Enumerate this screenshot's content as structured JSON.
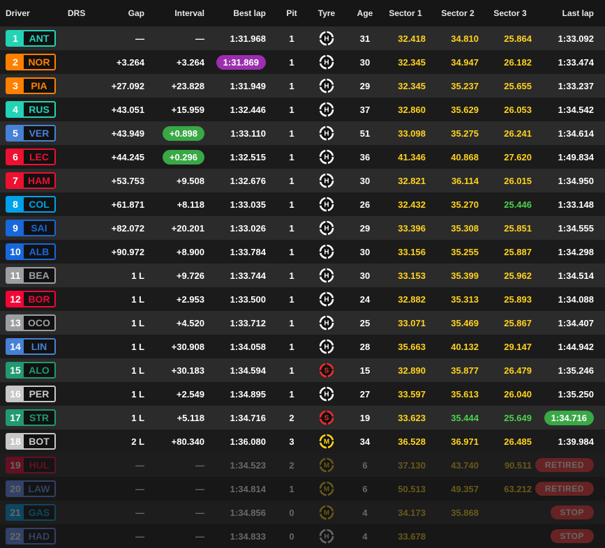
{
  "headers": {
    "driver": "Driver",
    "drs": "DRS",
    "gap": "Gap",
    "interval": "Interval",
    "best_lap": "Best lap",
    "pit": "Pit",
    "tyre": "Tyre",
    "age": "Age",
    "sector1": "Sector 1",
    "sector2": "Sector 2",
    "sector3": "Sector 3",
    "last_lap": "Last lap"
  },
  "tyre_colors": {
    "H": "#ffffff",
    "M": "#ffd21e",
    "S": "#ff2a2a"
  },
  "colors": {
    "fastest_purple": "#9b2fae",
    "personal_green": "#39a845",
    "sector_yellow": "#ffd21e",
    "retired_red": "#ff3b3b"
  },
  "rows": [
    {
      "pos": "1",
      "code": "ANT",
      "team": "#23d3b5",
      "gap": "—",
      "interval": "—",
      "best": "1:31.968",
      "pit": "1",
      "tyre": "H",
      "age": "31",
      "s1": "32.418",
      "s2": "34.810",
      "s3": "25.864",
      "last": "1:33.092"
    },
    {
      "pos": "2",
      "code": "NOR",
      "team": "#ff8000",
      "gap": "+3.264",
      "interval": "+3.264",
      "best": "1:31.869",
      "best_hl": "purple",
      "pit": "1",
      "tyre": "H",
      "age": "30",
      "s1": "32.345",
      "s2": "34.947",
      "s3": "26.182",
      "last": "1:33.474"
    },
    {
      "pos": "3",
      "code": "PIA",
      "team": "#ff8000",
      "gap": "+27.092",
      "interval": "+23.828",
      "best": "1:31.949",
      "pit": "1",
      "tyre": "H",
      "age": "29",
      "s1": "32.345",
      "s2": "35.237",
      "s3": "25.655",
      "last": "1:33.237"
    },
    {
      "pos": "4",
      "code": "RUS",
      "team": "#23d3b5",
      "gap": "+43.051",
      "interval": "+15.959",
      "best": "1:32.446",
      "pit": "1",
      "tyre": "H",
      "age": "37",
      "s1": "32.860",
      "s2": "35.629",
      "s3": "26.053",
      "last": "1:34.542"
    },
    {
      "pos": "5",
      "code": "VER",
      "team": "#4781d7",
      "gap": "+43.949",
      "interval": "+0.898",
      "int_hl": "green",
      "best": "1:33.110",
      "pit": "1",
      "tyre": "H",
      "age": "51",
      "s1": "33.098",
      "s2": "35.275",
      "s3": "26.241",
      "last": "1:34.614"
    },
    {
      "pos": "6",
      "code": "LEC",
      "team": "#ed1131",
      "gap": "+44.245",
      "interval": "+0.296",
      "int_hl": "green",
      "best": "1:32.515",
      "pit": "1",
      "tyre": "H",
      "age": "36",
      "s1": "41.346",
      "s2": "40.868",
      "s3": "27.620",
      "last": "1:49.834"
    },
    {
      "pos": "7",
      "code": "HAM",
      "team": "#ed1131",
      "gap": "+53.753",
      "interval": "+9.508",
      "best": "1:32.676",
      "pit": "1",
      "tyre": "H",
      "age": "30",
      "s1": "32.821",
      "s2": "36.114",
      "s3": "26.015",
      "last": "1:34.950"
    },
    {
      "pos": "8",
      "code": "COL",
      "team": "#00a1e8",
      "gap": "+61.871",
      "interval": "+8.118",
      "best": "1:33.035",
      "pit": "1",
      "tyre": "H",
      "age": "26",
      "s1": "32.432",
      "s2": "35.270",
      "s3": "25.446",
      "s3_c": "green",
      "last": "1:33.148"
    },
    {
      "pos": "9",
      "code": "SAI",
      "team": "#1868db",
      "gap": "+82.072",
      "interval": "+20.201",
      "best": "1:33.026",
      "pit": "1",
      "tyre": "H",
      "age": "29",
      "s1": "33.396",
      "s2": "35.308",
      "s3": "25.851",
      "last": "1:34.555"
    },
    {
      "pos": "10",
      "code": "ALB",
      "team": "#1868db",
      "gap": "+90.972",
      "interval": "+8.900",
      "best": "1:33.784",
      "pit": "1",
      "tyre": "H",
      "age": "30",
      "s1": "33.156",
      "s2": "35.255",
      "s3": "25.887",
      "last": "1:34.298"
    },
    {
      "pos": "11",
      "code": "BEA",
      "team": "#9c9fa2",
      "gap": "1 L",
      "interval": "+9.726",
      "best": "1:33.744",
      "pit": "1",
      "tyre": "H",
      "age": "30",
      "s1": "33.153",
      "s2": "35.399",
      "s3": "25.962",
      "last": "1:34.514"
    },
    {
      "pos": "12",
      "code": "BOR",
      "team": "#f50537",
      "gap": "1 L",
      "interval": "+2.953",
      "best": "1:33.500",
      "pit": "1",
      "tyre": "H",
      "age": "24",
      "s1": "32.882",
      "s2": "35.313",
      "s3": "25.893",
      "last": "1:34.088"
    },
    {
      "pos": "13",
      "code": "OCO",
      "team": "#9c9fa2",
      "gap": "1 L",
      "interval": "+4.520",
      "best": "1:33.712",
      "pit": "1",
      "tyre": "H",
      "age": "25",
      "s1": "33.071",
      "s2": "35.469",
      "s3": "25.867",
      "last": "1:34.407"
    },
    {
      "pos": "14",
      "code": "LIN",
      "team": "#4781d7",
      "gap": "1 L",
      "interval": "+30.908",
      "best": "1:34.058",
      "pit": "1",
      "tyre": "H",
      "age": "28",
      "s1": "35.663",
      "s2": "40.132",
      "s3": "29.147",
      "last": "1:44.942"
    },
    {
      "pos": "15",
      "code": "ALO",
      "team": "#229971",
      "gap": "1 L",
      "interval": "+30.183",
      "best": "1:34.594",
      "pit": "1",
      "tyre": "S",
      "age": "15",
      "s1": "32.890",
      "s2": "35.877",
      "s3": "26.479",
      "last": "1:35.246"
    },
    {
      "pos": "16",
      "code": "PER",
      "team": "#c8c8c8",
      "gap": "1 L",
      "interval": "+2.549",
      "best": "1:34.895",
      "pit": "1",
      "tyre": "H",
      "age": "27",
      "s1": "33.597",
      "s2": "35.613",
      "s3": "26.040",
      "last": "1:35.250"
    },
    {
      "pos": "17",
      "code": "STR",
      "team": "#229971",
      "gap": "1 L",
      "interval": "+5.118",
      "best": "1:34.716",
      "pit": "2",
      "tyre": "S",
      "age": "19",
      "s1": "33.623",
      "s2": "35.444",
      "s2_c": "green",
      "s3": "25.649",
      "s3_c": "green",
      "last": "1:34.716",
      "last_hl": "green"
    },
    {
      "pos": "18",
      "code": "BOT",
      "team": "#c8c8c8",
      "gap": "2 L",
      "interval": "+80.340",
      "best": "1:36.080",
      "pit": "3",
      "tyre": "M",
      "age": "34",
      "s1": "36.528",
      "s2": "36.971",
      "s3": "26.485",
      "last": "1:39.984"
    },
    {
      "pos": "19",
      "code": "HUL",
      "team": "#f50537",
      "gap": "—",
      "interval": "—",
      "best": "1:34.523",
      "pit": "2",
      "tyre": "M",
      "age": "6",
      "s1": "37.130",
      "s2": "43.740",
      "s3": "90.511",
      "last": "RETIRED",
      "dim": true
    },
    {
      "pos": "20",
      "code": "LAW",
      "team": "#6692ff",
      "gap": "—",
      "interval": "—",
      "best": "1:34.814",
      "pit": "1",
      "tyre": "M",
      "age": "6",
      "s1": "50.513",
      "s2": "49.357",
      "s3": "63.212",
      "last": "RETIRED",
      "dim": true
    },
    {
      "pos": "21",
      "code": "GAS",
      "team": "#00a1e8",
      "gap": "—",
      "interval": "—",
      "best": "1:34.856",
      "pit": "0",
      "tyre": "M",
      "age": "4",
      "s1": "34.173",
      "s2": "35.868",
      "s3": "",
      "last": "STOP",
      "dim": true
    },
    {
      "pos": "22",
      "code": "HAD",
      "team": "#6692ff",
      "gap": "—",
      "interval": "—",
      "best": "1:34.833",
      "pit": "0",
      "tyre": "H",
      "age": "4",
      "s1": "33.678",
      "s2": "",
      "s3": "",
      "last": "STOP",
      "dim": true
    }
  ]
}
